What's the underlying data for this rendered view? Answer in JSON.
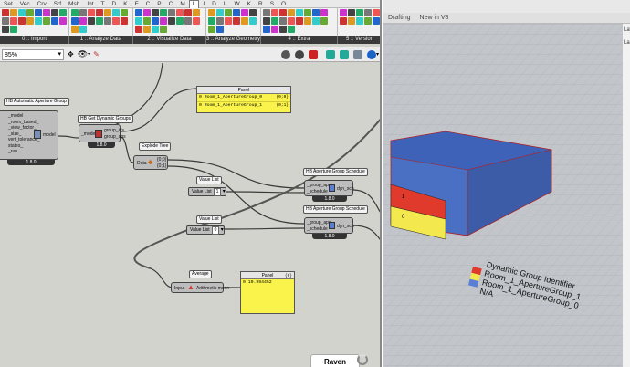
{
  "gh": {
    "tabs": [
      "Set",
      "Vec",
      "Crv",
      "Srf",
      "Msh",
      "Int",
      "T",
      "D",
      "K",
      "F",
      "C",
      "P",
      "C",
      "M",
      "L",
      "I",
      "D",
      "L",
      "W",
      "K",
      "R",
      "S",
      "O"
    ],
    "active_tab": "L",
    "group_labels": [
      "0 :: Import",
      "1 :: Analyze Data",
      "2 :: Visualize Data",
      "3 :: Analyze Geometry",
      "4 :: Extra",
      "5 :: Version"
    ],
    "zoom": "85%",
    "components": {
      "aperture_group": {
        "title": "HB Automatic Aperture Group",
        "inputs": [
          "_model",
          "_room_based_",
          "_view_factor_",
          "_size_",
          "vert_tolerance_",
          "states_",
          "_run"
        ],
        "output": "model",
        "version": "1.8.0"
      },
      "dynamic_groups": {
        "title": "HB Get Dynamic Groups",
        "input": "_model",
        "outputs": [
          "group_ids",
          "group_aps"
        ],
        "version": "1.8.0"
      },
      "explode_tree": {
        "title": "Explode Tree",
        "input": "Data",
        "outputs": [
          "{0;0}",
          "{0;1}"
        ]
      },
      "value_list_1": {
        "title": "Value List",
        "label": "Value List",
        "value": "1"
      },
      "value_list_0": {
        "title": "Value List",
        "label": "Value List",
        "value": "0"
      },
      "schedule_1": {
        "title": "HB Aperture Group Schedule",
        "inputs": [
          "_group_aps",
          "_schedule"
        ],
        "output": "dyn_sch",
        "version": "1.8.0"
      },
      "schedule_2": {
        "title": "HB Aperture Group Schedule",
        "inputs": [
          "_group_aps",
          "_schedule"
        ],
        "output": "dyn_sch",
        "version": "1.8.0"
      },
      "average": {
        "title": "Average",
        "input": "Input",
        "output": "Arithmetic mean"
      }
    },
    "panel_top": {
      "title": "Panel",
      "rows": [
        {
          "index": "{0;0}",
          "text": "0 Room_1_ApertureGroup_0"
        },
        {
          "index": "{0;1}",
          "text": "0 Room_1_ApertureGroup_1"
        }
      ]
    },
    "panel_avg": {
      "title": "Panel",
      "rows": [
        {
          "index": "{0}",
          "text": "0 10.994452"
        }
      ]
    },
    "raven_label": "Raven"
  },
  "rhino": {
    "tabs": [
      "Drafting",
      "New in V8"
    ],
    "side_label_1": "Lay",
    "side_label_2": "La",
    "box_labels": [
      "1",
      "0"
    ],
    "legend": {
      "title": "Dynamic Group Identifier",
      "items": [
        {
          "label": "Room_1_ApertureGroup_1",
          "color": "#e03a2d"
        },
        {
          "label": "Room_1_ApertureGroup_0",
          "color": "#f3e94e"
        },
        {
          "label": "N/A",
          "color": "#5a7fd6"
        }
      ]
    }
  }
}
